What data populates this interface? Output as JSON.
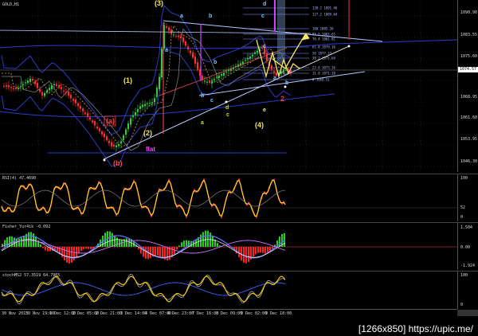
{
  "symbol_label": "GOLD,H1",
  "current_price": "1074.57",
  "chart_data": [
    {
      "type": "candlestick",
      "panel": "price",
      "y_ticks": [
        "1090.90",
        "1083.55",
        "1075.60",
        "1068.95",
        "1061.60",
        "1053.95",
        "1046.30"
      ],
      "fib_levels": [
        {
          "label": "138.2  1091.46",
          "color": "#9aa8ff"
        },
        {
          "label": "127.2  1089.64",
          "color": "#9aa8ff"
        },
        {
          "label": "100  1085.30",
          "color": "#9aa8ff"
        },
        {
          "label": "88.6  1083.65",
          "color": "#9aa8ff"
        },
        {
          "label": "76.4  1082.01",
          "color": "#9aa8ff"
        },
        {
          "label": "61.8  1079.16",
          "color": "#9aa8ff"
        },
        {
          "label": "50  1077.33",
          "color": "#9aa8ff"
        },
        {
          "label": "38.2  1075.64",
          "color": "#9aa8ff"
        },
        {
          "label": "23.6  1073.16",
          "color": "#9aa8ff"
        },
        {
          "label": "11.8  1071.20",
          "color": "#9aa8ff"
        },
        {
          "label": "0  1069.51",
          "color": "#9aa8ff"
        }
      ],
      "wave_labels": [
        {
          "text": "(3)",
          "color": "#f5e663"
        },
        {
          "text": "(1)",
          "color": "#f5e663"
        },
        {
          "text": "(2)",
          "color": "#f5e663"
        },
        {
          "text": "(4)",
          "color": "#f5e663"
        },
        {
          "text": "(a)",
          "color": "#ff4444"
        },
        {
          "text": "(b)",
          "color": "#ff4444"
        },
        {
          "text": "flat",
          "color": "#ff44ff"
        },
        {
          "text": "a",
          "color": "#7ec8ff"
        },
        {
          "text": "b",
          "color": "#7ec8ff"
        },
        {
          "text": "c",
          "color": "#7ec8ff"
        },
        {
          "text": "d",
          "color": "#7ec8ff"
        },
        {
          "text": "e",
          "color": "#7ec8ff"
        },
        {
          "text": "a",
          "color": "#7ec8ff"
        },
        {
          "text": "b",
          "color": "#7ec8ff"
        },
        {
          "text": "c",
          "color": "#7ec8ff"
        },
        {
          "text": "a",
          "color": "#c8d850"
        },
        {
          "text": "c",
          "color": "#c8d850"
        },
        {
          "text": "e",
          "color": "#c8d850"
        },
        {
          "text": "d",
          "color": "#c8d850"
        },
        {
          "text": "b",
          "color": "#7ec8ff"
        },
        {
          "text": "c",
          "color": "#7ec8ff"
        },
        {
          "text": "a",
          "color": "#7ec8ff"
        },
        {
          "text": "b",
          "color": "#7ec8ff"
        },
        {
          "text": "2",
          "color": "#ff3333"
        }
      ]
    },
    {
      "type": "line",
      "panel": "RSI",
      "title": "RSI(4) 47.4690",
      "y_ticks": [
        "100",
        "52",
        "0"
      ]
    },
    {
      "type": "histogram",
      "panel": "Fisher",
      "title": "Fisher_Yur4ik -0.092",
      "y_ticks": [
        "1.504",
        "0.00",
        "-1.924"
      ]
    },
    {
      "type": "line",
      "panel": "stoch",
      "title": "stochMS2 57.3519 64.7965",
      "y_ticks": [
        "100",
        "0"
      ]
    }
  ],
  "time_labels": [
    "30 Nov 2015",
    "30 Nov 19:00",
    "1 Dec 12:00",
    "2 Dec 05:00",
    "2 Dec 21:00",
    "3 Dec 14:00",
    "4 Dec 07:00",
    "4 Dec 23:00",
    "7 Dec 16:00",
    "8 Dec 09:00",
    "9 Dec 02:00",
    "9 Dec 18:00"
  ],
  "watermark": "[1266x850] https://upic.me/",
  "colors": {
    "bull_candle": "#2ecc40",
    "bear_candle": "#ff2e2e",
    "bb": "#2b3cc9",
    "ma_dashed": "#c8a050",
    "trend_line": "#b8c8ff",
    "rsi_main": "#ffe600",
    "fisher_pos": "#22d422",
    "fisher_neg": "#ff2020",
    "stoch_main": "#ffd000"
  }
}
